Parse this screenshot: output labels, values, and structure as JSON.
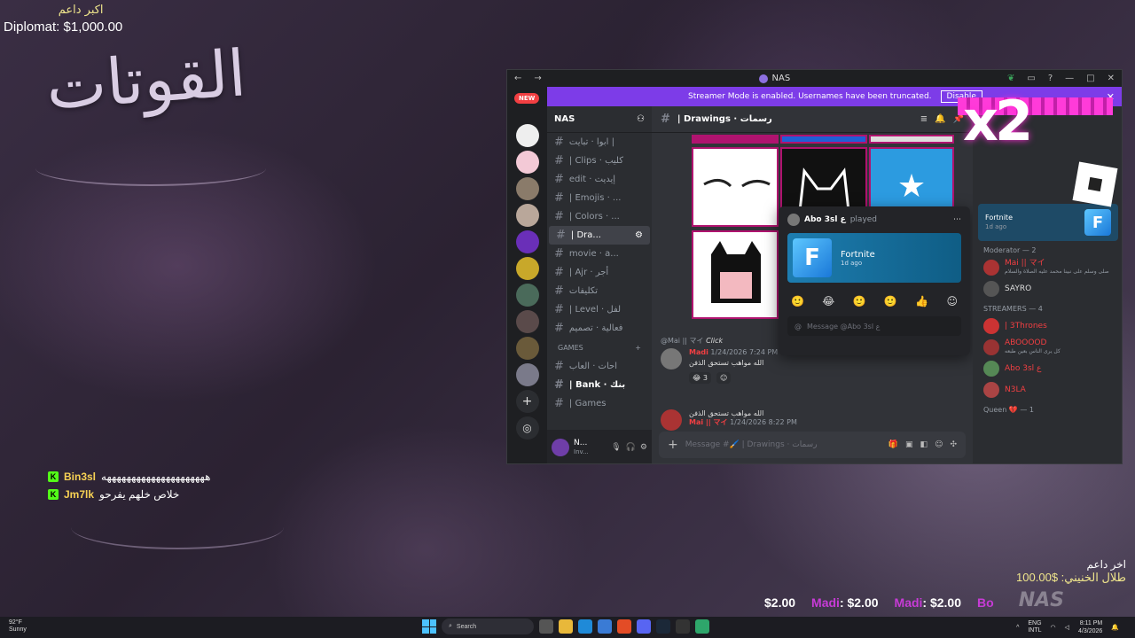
{
  "overlay": {
    "donor_top_label": "اكبر داعم",
    "donor_top_value": "Diplomat: $1,000.00",
    "logo_text": "القوتات",
    "last_donor_label": "اخر داعم",
    "last_donor_value": "طلال الخنيني: $100.00",
    "watermark": "NAS",
    "chat": [
      {
        "user": "Bin3sl",
        "message": "هههههههههههههههههههههه"
      },
      {
        "user": "Jm7lk",
        "message": "خلاص خلهم يفرحو"
      }
    ],
    "ticker": [
      {
        "name": "",
        "amount": "$2.00"
      },
      {
        "name": "Madi",
        "amount": ": $2.00"
      },
      {
        "name": "Madi",
        "amount": ": $2.00"
      },
      {
        "name": "Bo",
        "amount": ""
      }
    ],
    "x2_text": "x2"
  },
  "discord": {
    "window_title": "NAS",
    "banner_text": "Streamer Mode is enabled. Usernames have been truncated.",
    "banner_button": "Disable",
    "new_badge": "NEW",
    "server_name": "NAS",
    "channels": [
      {
        "label": "ابوا · تبايت |",
        "active": false
      },
      {
        "label": "| Clips · كليب",
        "active": false
      },
      {
        "label": "edit · إيديت",
        "active": false
      },
      {
        "label": "| Emojis · ...",
        "active": false
      },
      {
        "label": "| Colors · ...",
        "active": false
      },
      {
        "label": "| Dra...",
        "active": true
      },
      {
        "label": "movie · a...",
        "active": false
      },
      {
        "label": "| Ajr · أجر",
        "active": false
      },
      {
        "label": "تكليفات",
        "active": false
      },
      {
        "label": "| Level · لفل",
        "active": false
      },
      {
        "label": "فعالية · تصميم",
        "active": false
      }
    ],
    "category_games": "GAMES",
    "games_channels": [
      {
        "label": "احات · العاب"
      },
      {
        "label": "| Bank · بنك"
      },
      {
        "label": "| Games"
      }
    ],
    "user_name": "N...",
    "user_status": "Inv...",
    "channel_header": "| Drawings · رسمات",
    "messages": [
      {
        "name": "Madi",
        "time": "1/24/2026 7:24 PM",
        "text": "الله مواهب تستحق الذفن",
        "reaction_count": "3"
      },
      {
        "name": "Mai || マイ",
        "time": "1/24/2026 8:22 PM",
        "text": "الله مواهب تستحق الذفن"
      }
    ],
    "reply_preview": "@Mai || マイ",
    "reply_click": "Click",
    "composer_placeholder": "Message #🖌️ | Drawings · رسمات",
    "popup": {
      "user": "Abo 3sl ع",
      "action": "played",
      "game": "Fortnite",
      "ago": "1d ago",
      "input_placeholder": "Message @Abo 3sl ع",
      "reactions": [
        "🙂",
        "😂",
        "🙂",
        "🙂",
        "👍",
        "☺"
      ]
    },
    "members": {
      "activity_game": "Fortnite",
      "activity_ago": "1d ago",
      "moderator_header": "Moderator — 2",
      "moderators": [
        {
          "name": "Mai || マイ",
          "sub": "صلى وسلم على نبينا محمد عليه الصلاة والسلام"
        },
        {
          "name": "SAYRO",
          "sub": ""
        }
      ],
      "streamers_header": "STREAMERS — 4",
      "streamers": [
        {
          "name": "| 3Thrones",
          "sub": ""
        },
        {
          "name": "ABOOOOD",
          "sub": "كل يرى الناس بعين طبعه"
        },
        {
          "name": "Abo 3sl ع",
          "sub": ""
        },
        {
          "name": "N3LA",
          "sub": ""
        }
      ],
      "queen_header": "Queen 💔 — 1"
    }
  },
  "taskbar": {
    "weather_temp": "92°F",
    "weather_desc": "Sunny",
    "search_placeholder": "Search",
    "lang": "ENG",
    "region": "INTL",
    "time": "8:11 PM",
    "date": "4/3/2026"
  }
}
